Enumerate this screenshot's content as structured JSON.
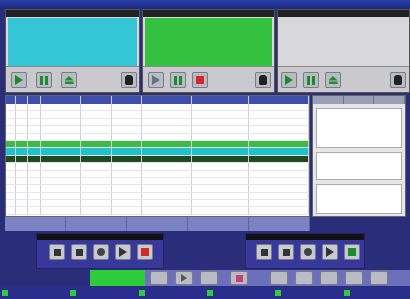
{
  "titlebar": {
    "left": "",
    "mid1": "",
    "mid2": "",
    "mid3": "",
    "right": ""
  },
  "decks": [
    {
      "name": "",
      "accent": "#34c6d6",
      "lines": [
        "",
        "",
        "",
        "",
        ""
      ]
    },
    {
      "name": "",
      "accent": "#34c140",
      "lines": [
        "",
        "",
        "",
        "",
        ""
      ]
    },
    {
      "name": "",
      "accent": "#d8d8dc",
      "lines": [
        "",
        "",
        "",
        "",
        ""
      ]
    }
  ],
  "playlist": {
    "columns": [
      "",
      "",
      "",
      "",
      "",
      "",
      "",
      "",
      ""
    ],
    "rows": [
      [
        "",
        "",
        "",
        "",
        "",
        "",
        "",
        "",
        ""
      ],
      [
        "",
        "",
        "",
        "",
        "",
        "",
        "",
        "",
        ""
      ],
      [
        "",
        "",
        "",
        "",
        "",
        "",
        "",
        "",
        ""
      ],
      [
        "",
        "",
        "",
        "",
        "",
        "",
        "",
        "",
        ""
      ],
      [
        "",
        "",
        "",
        "",
        "",
        "",
        "",
        "",
        ""
      ],
      [
        "",
        "",
        "",
        "",
        "",
        "",
        "",
        "",
        ""
      ],
      [
        "",
        "",
        "",
        "",
        "",
        "",
        "",
        "",
        ""
      ],
      [
        "",
        "",
        "",
        "",
        "",
        "",
        "",
        "",
        ""
      ],
      [
        "",
        "",
        "",
        "",
        "",
        "",
        "",
        "",
        ""
      ],
      [
        "",
        "",
        "",
        "",
        "",
        "",
        "",
        "",
        ""
      ],
      [
        "",
        "",
        "",
        "",
        "",
        "",
        "",
        "",
        ""
      ],
      [
        "",
        "",
        "",
        "",
        "",
        "",
        "",
        "",
        ""
      ],
      [
        "",
        "",
        "",
        "",
        "",
        "",
        "",
        "",
        ""
      ],
      [
        "",
        "",
        "",
        "",
        "",
        "",
        "",
        "",
        ""
      ],
      [
        "",
        "",
        "",
        "",
        "",
        "",
        "",
        "",
        ""
      ]
    ]
  },
  "info_panel": {
    "tabs": [
      "",
      "",
      ""
    ],
    "box1": [
      "",
      "",
      "",
      "",
      ""
    ],
    "box2": [
      "",
      "",
      "",
      ""
    ]
  },
  "toolbar": [
    "",
    "",
    "",
    "",
    ""
  ],
  "status": [
    "",
    "",
    "",
    "",
    "",
    ""
  ]
}
